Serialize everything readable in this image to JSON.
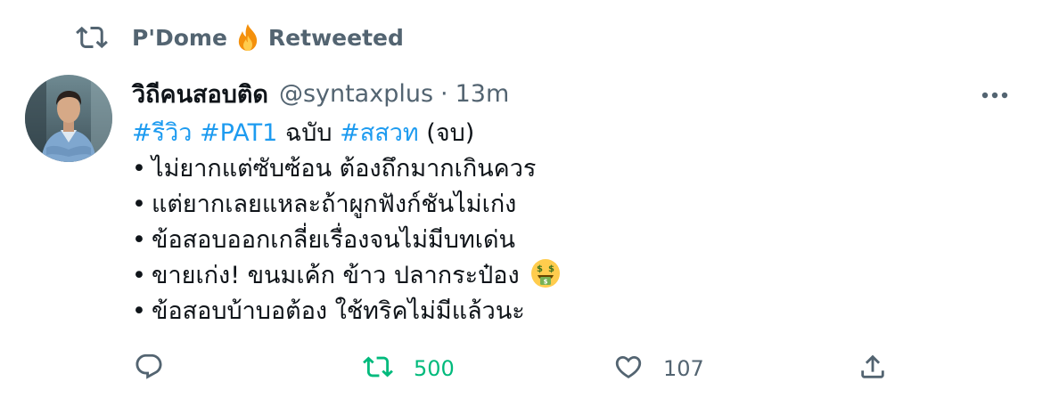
{
  "retweet_header": {
    "retweeter": "P'Dome",
    "emoji": "fire-icon",
    "label": "Retweeted"
  },
  "tweet": {
    "display_name": "วิถีคนสอบติด",
    "handle": "@syntaxplus",
    "separator": "·",
    "time": "13m",
    "line1": {
      "hashtag1": "#รีวิว",
      "hashtag2": "#PAT1",
      "text1": "ฉบับ",
      "hashtag3": "#สสวท",
      "text2": "(จบ)"
    },
    "bullet_char": "•",
    "bullets": [
      "ไม่ยากแต่ซับซ้อน ต้องถึกมากเกินควร",
      "แต่ยากเลยแหละถ้าผูกฟังก์ชันไม่เก่ง",
      "ข้อสอบออกเกลี่ยเรื่องจนไม่มีบทเด่น",
      "ขายเก่ง! ขนมเค้ก ข้าว ปลากระป๋อง",
      "ข้อสอบบ้าบอต้อง ใช้ทริคไม่มีแล้วนะ"
    ],
    "bullet4_emoji": "money-mouth-face-icon"
  },
  "actions": {
    "reply_icon": "reply-icon",
    "retweet_icon": "retweet-icon",
    "retweet_count": "500",
    "retweet_color": "#00ba7c",
    "like_icon": "heart-icon",
    "like_count": "107",
    "share_icon": "share-icon"
  },
  "colors": {
    "link": "#1d9bf0",
    "secondary_text": "#536471",
    "primary_text": "#0f1419"
  }
}
